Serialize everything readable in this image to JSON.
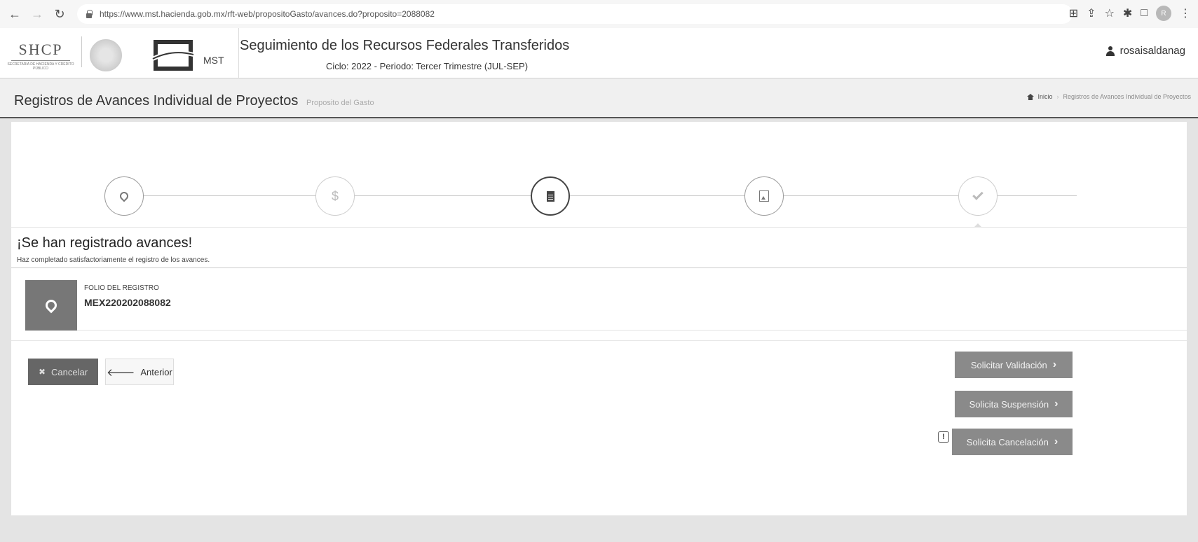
{
  "browser": {
    "url": "https://www.mst.hacienda.gob.mx/rft-web/propositoGasto/avances.do?proposito=2088082",
    "avatar_initial": "R"
  },
  "header": {
    "logo_text": "SHCP",
    "logo_subtext": "SECRETARÍA DE HACIENDA Y CRÉDITO PÚBLICO",
    "mst_label": "MST",
    "system_title": "Seguimiento de los Recursos Federales Transferidos",
    "cycle_text": "Ciclo: 2022 - Periodo: Tercer Trimestre (JUL-SEP)",
    "username": "rosaisaldanag"
  },
  "page": {
    "title": "Registros de Avances Individual de Proyectos",
    "subtitle": "Proposito del Gasto",
    "breadcrumb": {
      "home": "Inicio",
      "current": "Registros de Avances Individual de Proyectos"
    }
  },
  "wizard": {
    "steps": [
      {
        "icon": "map-marker-icon",
        "state": "done"
      },
      {
        "icon": "dollar-icon",
        "state": "pending"
      },
      {
        "icon": "document-icon",
        "state": "active"
      },
      {
        "icon": "image-icon",
        "state": "done"
      },
      {
        "icon": "check-icon",
        "state": "current"
      }
    ]
  },
  "result": {
    "heading": "¡Se han registrado avances!",
    "message": "Haz completado satisfactoriamente el registro de los avances.",
    "folio_label": "FOLIO DEL REGISTRO",
    "folio_value": "MEX220202088082"
  },
  "actions": {
    "cancel": "Cancelar",
    "previous": "Anterior",
    "request_validation": "Solicitar Validación",
    "request_suspension": "Solicita Suspensión",
    "request_cancellation": "Solicita Cancelación",
    "info_symbol": "!"
  }
}
